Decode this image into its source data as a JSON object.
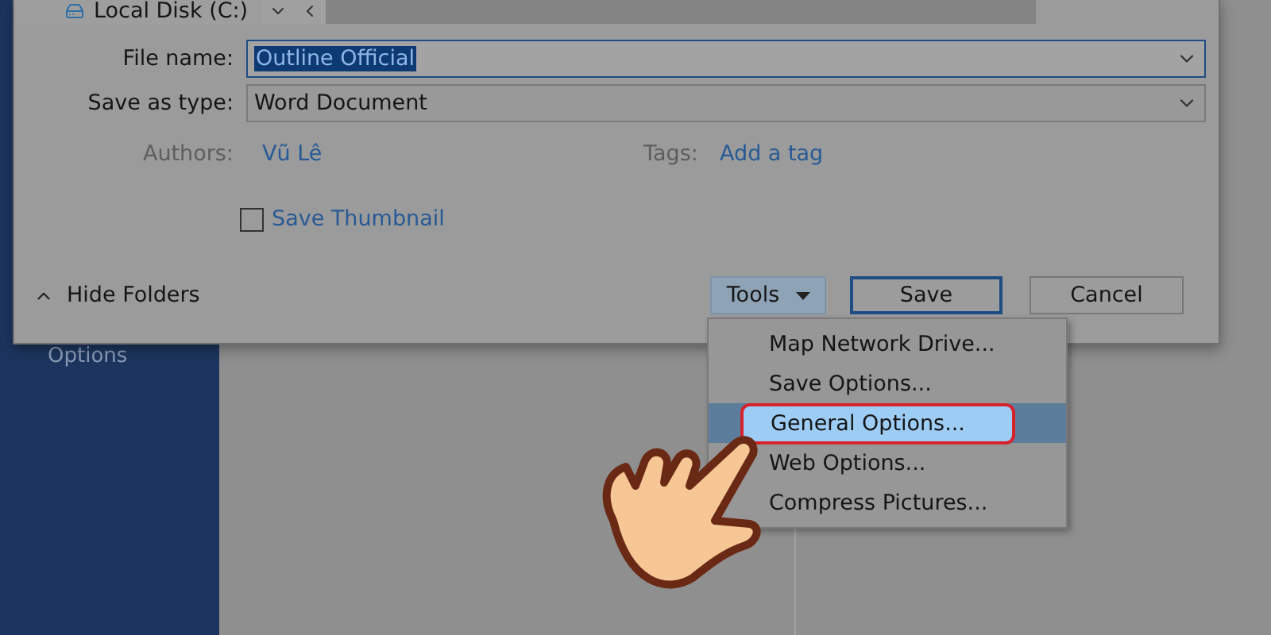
{
  "background": {
    "sidebar_item": "Options"
  },
  "dialog": {
    "folder": "Local Disk (C:)",
    "file_name": {
      "label": "File name:",
      "value": "Outline Official"
    },
    "save_as_type": {
      "label": "Save as type:",
      "value": "Word Document"
    },
    "authors": {
      "label": "Authors:",
      "value": "Vũ Lê"
    },
    "tags": {
      "label": "Tags:",
      "value": "Add a tag"
    },
    "save_thumbnail": {
      "label": "Save Thumbnail",
      "checked": false
    },
    "hide_folders": "Hide Folders",
    "buttons": [
      {
        "label": "Tools",
        "kind": "menu"
      },
      {
        "label": "Save",
        "kind": "default"
      },
      {
        "label": "Cancel",
        "kind": "plain"
      }
    ]
  },
  "tools_menu": {
    "items": [
      {
        "label": "Map Network Drive...",
        "selected": false
      },
      {
        "label": "Save Options...",
        "selected": false
      },
      {
        "label": "General Options...",
        "selected": true
      },
      {
        "label": "Web Options...",
        "selected": false
      },
      {
        "label": "Compress Pictures...",
        "selected": false
      }
    ]
  }
}
